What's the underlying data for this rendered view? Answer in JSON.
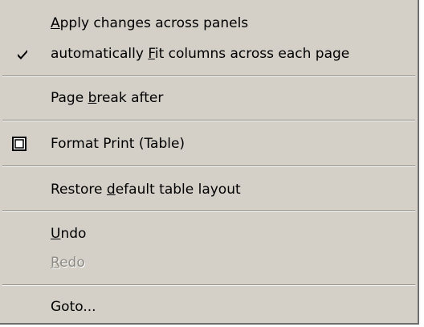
{
  "menu": {
    "items": [
      {
        "id": "apply",
        "pre": "",
        "mn": "A",
        "post": "pply changes across panels",
        "checked": false,
        "icon": "",
        "disabled": false
      },
      {
        "id": "autofit",
        "pre": "automatically ",
        "mn": "F",
        "post": "it columns across each page",
        "checked": true,
        "icon": "checkmark-icon",
        "disabled": false
      },
      {
        "id": "pagebreak",
        "pre": "Page ",
        "mn": "b",
        "post": "reak after",
        "checked": false,
        "icon": "",
        "disabled": false
      },
      {
        "id": "format",
        "pre": "Format Print (Table)",
        "mn": "",
        "post": "",
        "checked": false,
        "icon": "table-frame-icon",
        "disabled": false
      },
      {
        "id": "restore",
        "pre": "Restore ",
        "mn": "d",
        "post": "efault table layout",
        "checked": false,
        "icon": "",
        "disabled": false
      },
      {
        "id": "undo",
        "pre": "",
        "mn": "U",
        "post": "ndo",
        "checked": false,
        "icon": "",
        "disabled": false
      },
      {
        "id": "redo",
        "pre": "",
        "mn": "R",
        "post": "edo",
        "checked": false,
        "icon": "",
        "disabled": true
      },
      {
        "id": "goto",
        "pre": "Goto...",
        "mn": "",
        "post": "",
        "checked": false,
        "icon": "",
        "disabled": false
      }
    ]
  }
}
